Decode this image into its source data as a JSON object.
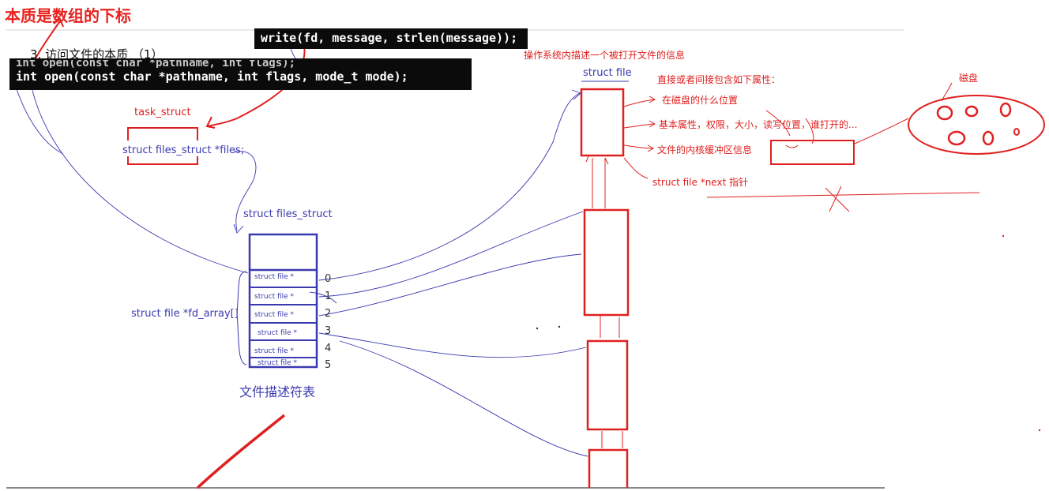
{
  "heading": "本质是数组的下标",
  "section_title": "3. 访问文件的本质 （1）",
  "code": {
    "write_line": "write(fd, message, strlen(message)); //",
    "open_line_faded": "int open(const char *pathname, int flags);",
    "open_line": "int open(const char *pathname, int flags, mode_t mode);"
  },
  "task_struct": {
    "label": "task_struct",
    "field": "struct files_struct *files;"
  },
  "files_struct": {
    "label": "struct files_struct",
    "array_label": "struct file *fd_array[]",
    "slots": [
      "struct file *",
      "struct file *",
      "struct file *",
      "struct file *",
      "struct file *",
      "struct file *"
    ],
    "indices": [
      "0",
      "1",
      "2",
      "3",
      "4",
      "5"
    ],
    "caption": "文件描述符表"
  },
  "os_note": "操作系统内描述一个被打开文件的信息",
  "struct_file": {
    "label": "struct file",
    "attrs_title": "直接或者间接包含如下属性：",
    "attrs": [
      "在磁盘的什么位置",
      "基本属性，权限，大小，读写位置，谁打开的...",
      "文件的内核缓冲区信息"
    ],
    "next_ptr": "struct file *next 指针"
  },
  "disk": {
    "label": "磁盘"
  },
  "colors": {
    "red": "#e02020",
    "blue": "#3a3ab0",
    "code_bg": "#0b0b0b"
  }
}
